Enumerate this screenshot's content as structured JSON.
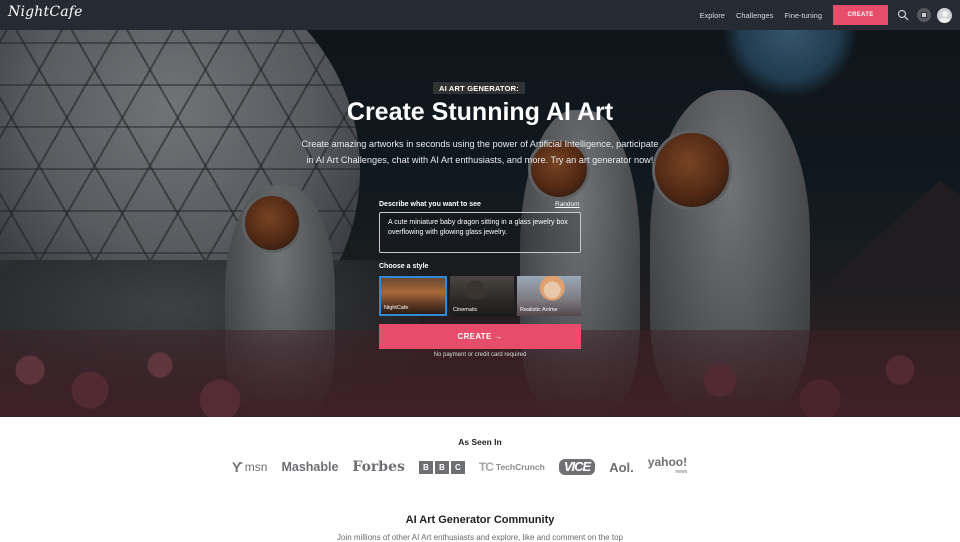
{
  "nav": {
    "logo": "NightCafe",
    "links": [
      "Explore",
      "Challenges",
      "Fine-tuning"
    ],
    "create_label": "CREATE",
    "colors": {
      "background": "#262a33",
      "accent": "#e84c6b"
    }
  },
  "hero": {
    "badge": "AI ART GENERATOR:",
    "title": "Create Stunning AI Art",
    "subtitle": "Create amazing artworks in seconds using the power of Artificial Intelligence, participate in AI Art Challenges, chat with AI Art enthusiasts, and more. Try an art generator now!",
    "prompt_label": "Describe what you want to see",
    "random_label": "Random",
    "prompt_value": "A cute miniature baby dragon sitting in a glass jewelry box overflowing with glowing glass jewelry.",
    "style_label": "Choose a style",
    "styles": [
      {
        "name": "NightCafe",
        "selected": true
      },
      {
        "name": "Cinematic",
        "selected": false
      },
      {
        "name": "Realistic Anime",
        "selected": false
      }
    ],
    "create_label": "CREATE →",
    "no_payment": "No payment or credit card required"
  },
  "seen_in": {
    "title": "As Seen In",
    "logos": {
      "msn": "msn",
      "mashable": "Mashable",
      "forbes": "Forbes",
      "bbc": [
        "B",
        "B",
        "C"
      ],
      "techcrunch_mark": "TC",
      "techcrunch": "TechCrunch",
      "vice": "VICE",
      "aol": "Aol.",
      "yahoo": "yahoo!",
      "yahoo_sub": "news"
    }
  },
  "community": {
    "title": "AI Art Generator Community",
    "subtitle": "Join millions of other AI Art enthusiasts and explore, like and comment on the top"
  }
}
